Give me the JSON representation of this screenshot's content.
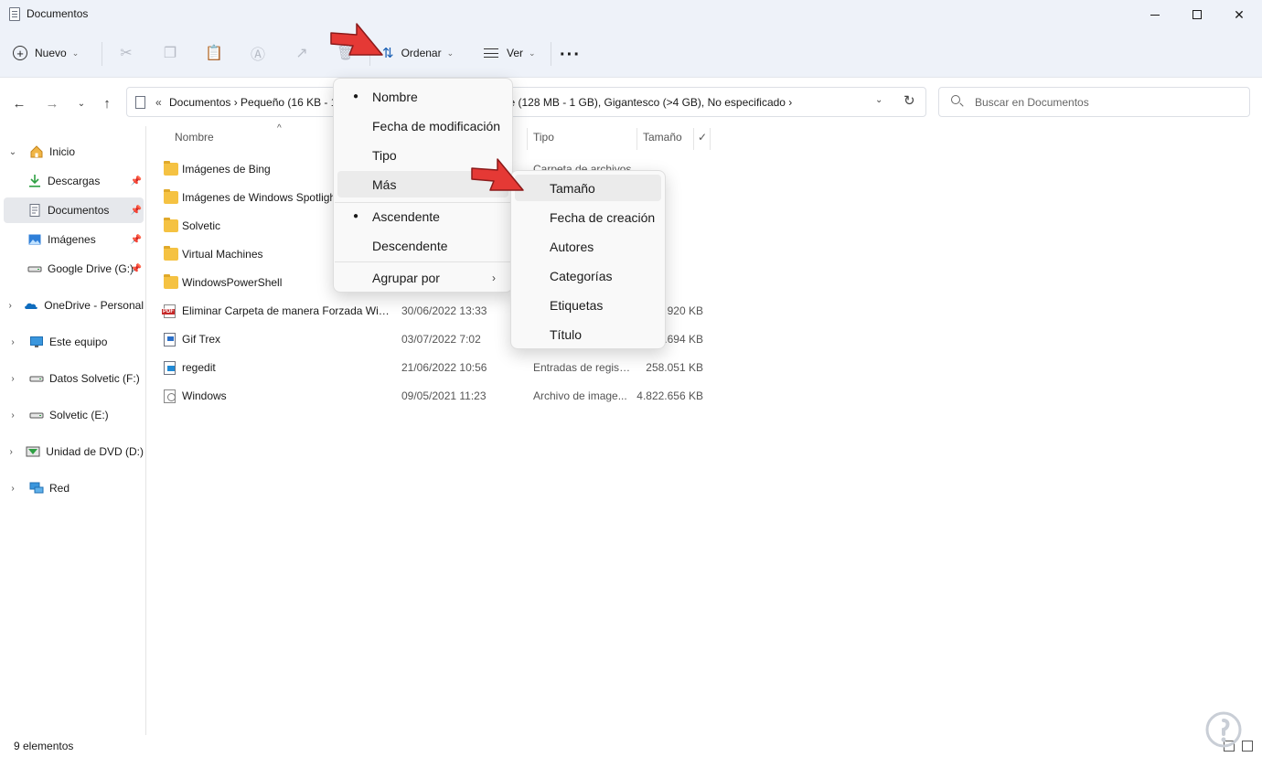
{
  "window": {
    "title": "Documentos",
    "minimize_icon": "minimize-icon",
    "maximize_icon": "maximize-icon",
    "close_icon": "close-icon"
  },
  "toolbar": {
    "new_label": "Nuevo",
    "sort_label": "Ordenar",
    "view_label": "Ver",
    "more_label": "···",
    "icons": [
      "cut-icon",
      "copy-icon",
      "paste-icon",
      "rename-icon",
      "share-icon",
      "delete-icon"
    ]
  },
  "address": {
    "prefix": "«",
    "path": "Documentos  ›  Pequeño (16 KB - 1 MB), Mediano (1 - 128 MB), Grande (128 MB - 1 GB), Gigantesco (>4 GB), No especificado  ›",
    "search_placeholder": "Buscar en Documentos"
  },
  "sidebar": {
    "items": [
      {
        "label": "Inicio",
        "icon": "home-icon"
      },
      {
        "label": "Descargas",
        "icon": "download-icon"
      },
      {
        "label": "Documentos",
        "icon": "documents-icon"
      },
      {
        "label": "Imágenes",
        "icon": "pictures-icon"
      },
      {
        "label": "Google Drive (G:)",
        "icon": "drive-icon"
      },
      {
        "label": "OneDrive - Personal",
        "icon": "onedrive-icon"
      },
      {
        "label": "Este equipo",
        "icon": "computer-icon"
      },
      {
        "label": "Datos Solvetic (F:)",
        "icon": "drive-icon"
      },
      {
        "label": "Solvetic (E:)",
        "icon": "drive-icon"
      },
      {
        "label": "Unidad de DVD (D:)",
        "icon": "dvd-icon"
      },
      {
        "label": "Red",
        "icon": "network-icon"
      }
    ]
  },
  "columns": {
    "name": "Nombre",
    "type": "Tipo",
    "size": "Tamaño"
  },
  "files": [
    {
      "name": "Imágenes de Bing",
      "date": "",
      "type": "Carpeta de archivos",
      "size": "",
      "icon": "folder-icon"
    },
    {
      "name": "Imágenes de Windows Spotlight",
      "date": "",
      "type": "",
      "size": "",
      "icon": "folder-icon"
    },
    {
      "name": "Solvetic",
      "date": "",
      "type": "",
      "size": "",
      "icon": "folder-icon"
    },
    {
      "name": "Virtual Machines",
      "date": "",
      "type": "",
      "size": "",
      "icon": "folder-icon"
    },
    {
      "name": "WindowsPowerShell",
      "date": "",
      "type": "",
      "size": "",
      "icon": "folder-icon"
    },
    {
      "name": "Eliminar Carpeta de manera Forzada Win...",
      "date": "30/06/2022 13:33",
      "type": "",
      "size": "920 KB",
      "icon": "pdf-icon"
    },
    {
      "name": "Gif Trex",
      "date": "03/07/2022 7:02",
      "type": "",
      "size": "5.694 KB",
      "icon": "gif-file-icon"
    },
    {
      "name": "regedit",
      "date": "21/06/2022 10:56",
      "type": "Entradas de registro",
      "size": "258.051 KB",
      "icon": "registry-file-icon"
    },
    {
      "name": "Windows",
      "date": "09/05/2021 11:23",
      "type": "Archivo de image...",
      "size": "4.822.656 KB",
      "icon": "disc-image-icon"
    }
  ],
  "sort_menu": {
    "items": [
      "Nombre",
      "Fecha de modificación",
      "Tipo",
      "Más",
      "Ascendente",
      "Descendente",
      "Agrupar por"
    ]
  },
  "more_menu": {
    "items": [
      "Tamaño",
      "Fecha de creación",
      "Autores",
      "Categorías",
      "Etiquetas",
      "Título"
    ]
  },
  "status": {
    "count": "9 elementos"
  },
  "colors": {
    "accent": "#1a5fb4",
    "arrow": "#e53935",
    "toolbar_bg": "#eef2f9",
    "folder": "#f5c242"
  }
}
